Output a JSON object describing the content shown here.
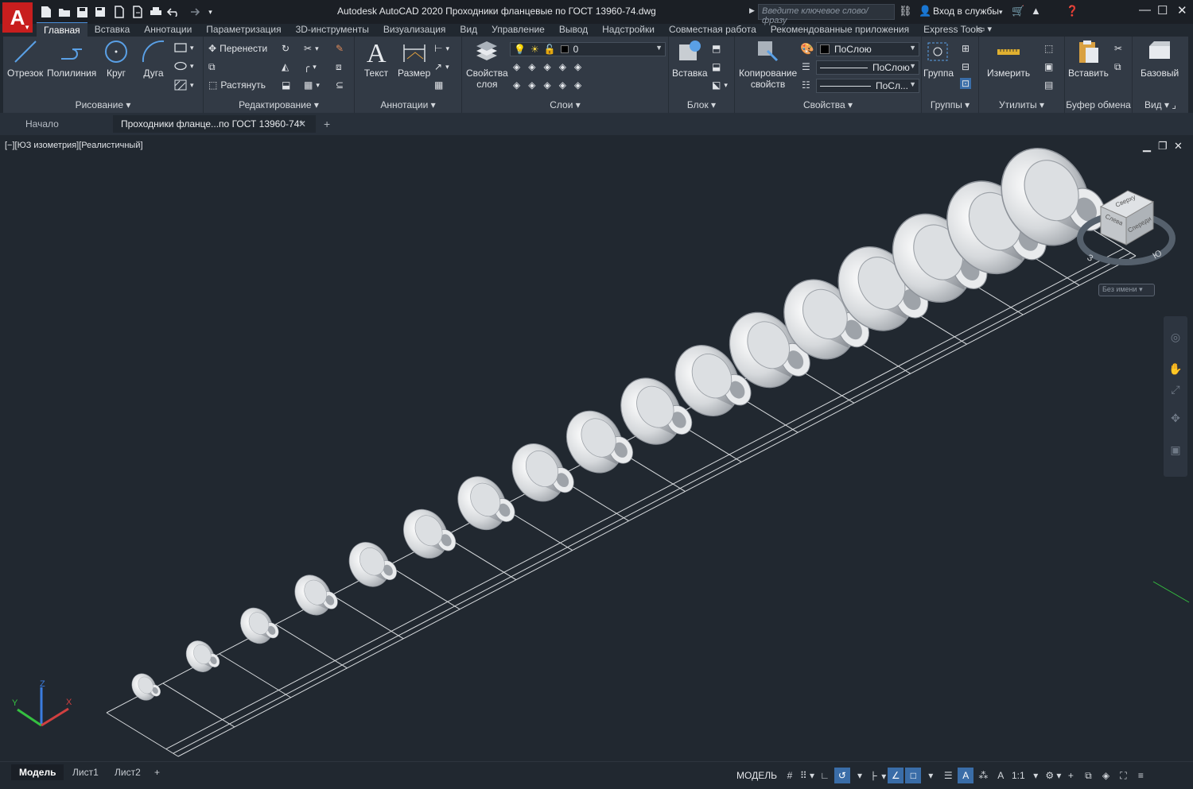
{
  "app": {
    "logo_letter": "A",
    "title": "Autodesk AutoCAD 2020   Проходники фланцевые по ГОСТ 13960-74.dwg",
    "search_placeholder": "Введите ключевое слово/фразу",
    "signin_label": "Вход в службы"
  },
  "ribbon_tabs": [
    "Главная",
    "Вставка",
    "Аннотации",
    "Параметризация",
    "3D-инструменты",
    "Визуализация",
    "Вид",
    "Управление",
    "Вывод",
    "Надстройки",
    "Совместная работа",
    "Рекомендованные приложения",
    "Express Tools"
  ],
  "ribbon": {
    "draw": {
      "title": "Рисование",
      "line": "Отрезок",
      "polyline": "Полилиния",
      "circle": "Круг",
      "arc": "Дуга"
    },
    "modify": {
      "title": "Редактирование",
      "move": "Перенести",
      "stretch": "Растянуть"
    },
    "annotation": {
      "title": "Аннотации",
      "text": "Текст",
      "dimension": "Размер"
    },
    "layers": {
      "title": "Слои",
      "properties_line1": "Свойства",
      "properties_line2": "слоя",
      "current_layer": "0"
    },
    "block": {
      "title": "Блок",
      "insert": "Вставка"
    },
    "properties": {
      "title": "Свойства",
      "match_line1": "Копирование",
      "match_line2": "свойств",
      "color": "ПоСлою",
      "linetype": "ПоСлою",
      "lineweight": "ПоСл..."
    },
    "groups": {
      "title": "Группы",
      "group": "Группа"
    },
    "utilities": {
      "title": "Утилиты",
      "measure": "Измерить"
    },
    "clipboard": {
      "title": "Буфер обмена",
      "paste": "Вставить"
    },
    "view": {
      "title": "Вид",
      "base": "Базовый"
    }
  },
  "doc_tabs": {
    "start": "Начало",
    "active": "Проходники фланце...по ГОСТ 13960-74*"
  },
  "viewport": {
    "label": "[−][ЮЗ изометрия][Реалистичный]",
    "viewcube": {
      "top": "Сверху",
      "front": "Спереди",
      "left": "Слева",
      "wcs": "Без имени"
    },
    "flange_count": 17
  },
  "status": {
    "layout_tabs": [
      "Модель",
      "Лист1",
      "Лист2"
    ],
    "model_label": "МОДЕЛЬ",
    "scale": "1:1"
  },
  "colors": {
    "accent": "#3a6da8",
    "logo_red": "#c81e1e",
    "viewport_bg": "#212830",
    "ribbon_bg": "#323a45"
  }
}
